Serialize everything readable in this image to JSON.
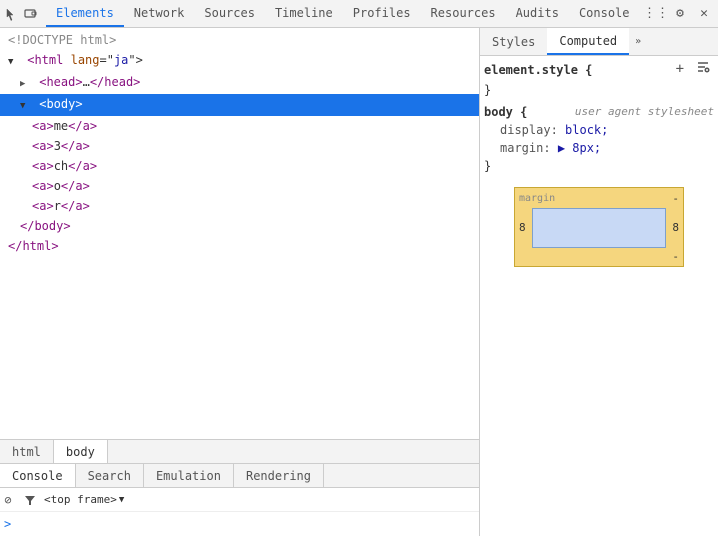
{
  "toolbar": {
    "inspect_icon": "⊕",
    "device_icon": "▭",
    "tabs": [
      {
        "label": "Elements",
        "active": true
      },
      {
        "label": "Network"
      },
      {
        "label": "Sources"
      },
      {
        "label": "Timeline"
      },
      {
        "label": "Profiles"
      },
      {
        "label": "Resources"
      },
      {
        "label": "Audits"
      },
      {
        "label": "Console"
      }
    ],
    "right_icons": [
      "⋮⋮",
      "⚙",
      "✕"
    ]
  },
  "dom_tree": {
    "lines": [
      {
        "text": "<!DOCTYPE html>",
        "indent": 1,
        "type": "comment"
      },
      {
        "text": "▼ <html lang=\"ja\">",
        "indent": 1,
        "type": "tag"
      },
      {
        "text": "▶ <head>…</head>",
        "indent": 2,
        "type": "tag"
      },
      {
        "text": "▼ <body>",
        "indent": 2,
        "type": "tag",
        "selected": true
      },
      {
        "text": "<a>me</a>",
        "indent": 3,
        "type": "tag"
      },
      {
        "text": "<a>3</a>",
        "indent": 3,
        "type": "tag"
      },
      {
        "text": "<a>ch</a>",
        "indent": 3,
        "type": "tag"
      },
      {
        "text": "<a>o</a>",
        "indent": 3,
        "type": "tag"
      },
      {
        "text": "<a>r</a>",
        "indent": 3,
        "type": "tag"
      },
      {
        "text": "</body>",
        "indent": 2,
        "type": "tag"
      },
      {
        "text": "</html>",
        "indent": 1,
        "type": "tag"
      }
    ]
  },
  "bottom_tabs": [
    {
      "label": "html",
      "active": false
    },
    {
      "label": "body",
      "active": true
    }
  ],
  "console_tabs": [
    {
      "label": "Console",
      "active": true
    },
    {
      "label": "Search"
    },
    {
      "label": "Emulation"
    },
    {
      "label": "Rendering"
    }
  ],
  "console": {
    "frame_label": "<top frame>",
    "prompt": ">"
  },
  "styles_panel": {
    "tabs": [
      {
        "label": "Styles",
        "active": false
      },
      {
        "label": "Computed",
        "active": true
      }
    ],
    "element_style": {
      "selector": "element.style {",
      "close": "}"
    },
    "body_rule": {
      "selector": "body {",
      "comment": "user agent stylesheet",
      "properties": [
        {
          "prop": "display:",
          "value": "block;"
        },
        {
          "prop": "margin:",
          "value": "▶ 8px;"
        }
      ],
      "close": "}"
    },
    "box_model": {
      "label": "margin",
      "value": "8"
    }
  }
}
